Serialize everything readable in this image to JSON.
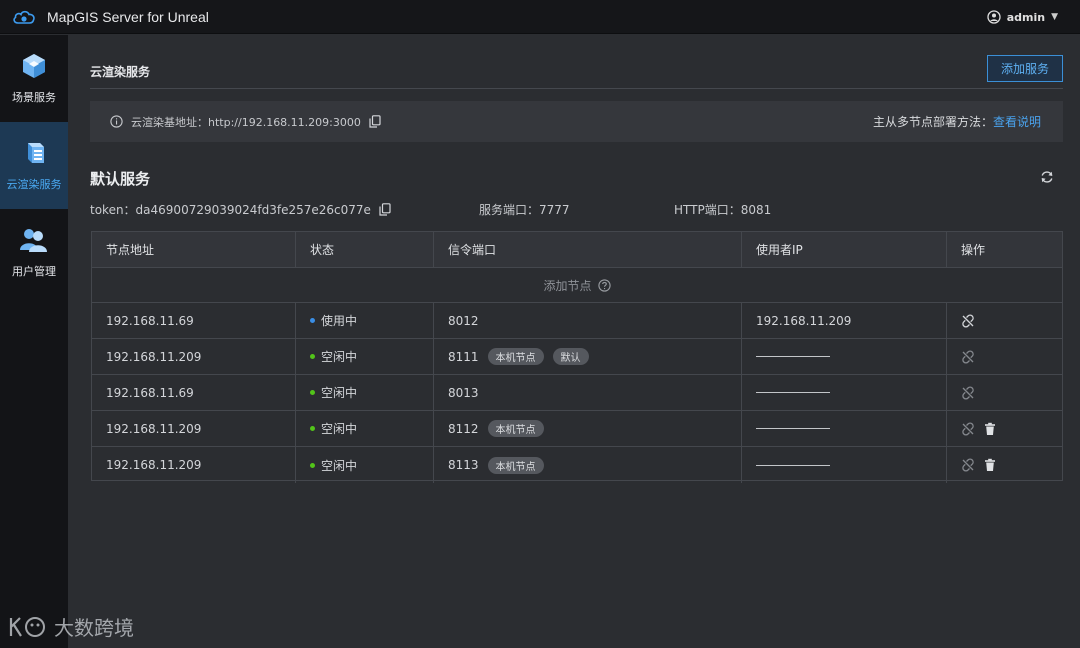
{
  "app": {
    "title": "MapGIS Server for Unreal",
    "user": "admin"
  },
  "sidebar": {
    "items": [
      {
        "label": "场景服务",
        "icon": "cube-icon"
      },
      {
        "label": "云渲染服务",
        "icon": "server-icon"
      },
      {
        "label": "用户管理",
        "icon": "users-icon"
      }
    ],
    "active": "云渲染服务"
  },
  "page": {
    "title": "云渲染服务",
    "add_button": "添加服务",
    "info": {
      "base_url_text": "云渲染基地址：http://192.168.11.209:3000",
      "deploy_label": "主从多节点部署方法：",
      "deploy_link": "查看说明"
    }
  },
  "service": {
    "title": "默认服务",
    "token_text": "token：da46900729039024fd3fe257e26c077e",
    "service_port_text": "服务端口：7777",
    "http_port_text": "HTTP端口：8081"
  },
  "table": {
    "columns": [
      "节点地址",
      "状态",
      "信令端口",
      "使用者IP",
      "操作"
    ],
    "add_node_label": "添加节点",
    "rows": [
      {
        "address": "192.168.11.69",
        "status": "使用中",
        "status_color": "#3a8ee6",
        "port": "8012",
        "tags": [],
        "user_ip": "192.168.11.209",
        "ops": [
          "unlink-icon"
        ]
      },
      {
        "address": "192.168.11.209",
        "status": "空闲中",
        "status_color": "#52c41a",
        "port": "8111",
        "tags": [
          "本机节点",
          "默认"
        ],
        "user_ip": "",
        "ops": [
          "unlink-icon"
        ]
      },
      {
        "address": "192.168.11.69",
        "status": "空闲中",
        "status_color": "#52c41a",
        "port": "8013",
        "tags": [],
        "user_ip": "",
        "ops": [
          "unlink-icon"
        ]
      },
      {
        "address": "192.168.11.209",
        "status": "空闲中",
        "status_color": "#52c41a",
        "port": "8112",
        "tags": [
          "本机节点"
        ],
        "user_ip": "",
        "ops": [
          "unlink-icon",
          "trash-icon"
        ]
      },
      {
        "address": "192.168.11.209",
        "status": "空闲中",
        "status_color": "#52c41a",
        "port": "8113",
        "tags": [
          "本机节点"
        ],
        "user_ip": "",
        "ops": [
          "unlink-icon",
          "trash-icon"
        ]
      }
    ]
  },
  "watermark": {
    "text": "大数跨境"
  },
  "colors": {
    "accent": "#4aa3ee",
    "sidebar_active": "#1d3954",
    "topbar": "#151619",
    "panel": "#2b2d31"
  }
}
